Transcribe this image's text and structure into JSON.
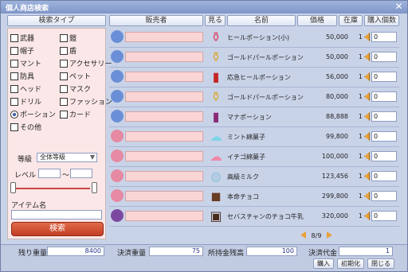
{
  "window": {
    "title": "個人商店検索",
    "close_glyph": "✕"
  },
  "left": {
    "header": "検索タイプ",
    "checkboxes": [
      {
        "label": "武器",
        "checked": false
      },
      {
        "label": "鎧",
        "checked": false
      },
      {
        "label": "帽子",
        "checked": false
      },
      {
        "label": "盾",
        "checked": false
      },
      {
        "label": "マント",
        "checked": false
      },
      {
        "label": "アクセサリー",
        "checked": false
      },
      {
        "label": "防具",
        "checked": false
      },
      {
        "label": "ペット",
        "checked": false
      },
      {
        "label": "ヘッド",
        "checked": false
      },
      {
        "label": "マスク",
        "checked": false
      },
      {
        "label": "ドリル",
        "checked": false
      },
      {
        "label": "ファッション",
        "checked": false
      },
      {
        "label": "ポーション",
        "checked": true
      },
      {
        "label": "カード",
        "checked": false
      },
      {
        "label": "その他",
        "checked": false
      }
    ],
    "grade_label": "等級",
    "grade_value": "全体等級",
    "level_label": "レベル",
    "level_sep": "～",
    "item_name_label": "アイテム名",
    "item_name_value": "",
    "search_button": "検索"
  },
  "table": {
    "headers": {
      "seller": "販売者",
      "view": "見る",
      "name": "名前",
      "price": "価格",
      "stock": "在庫",
      "qty": "購入個数"
    },
    "rows": [
      {
        "name": "ヒールポーション(小)",
        "price": "50,000",
        "stock": "1",
        "qty": "0",
        "seller_icon": "blue-spiky-avatar",
        "item_icon": "small-heal-potion-icon"
      },
      {
        "name": "ゴールドパールポーション",
        "price": "50,000",
        "stock": "1",
        "qty": "0",
        "seller_icon": "blue-spiky-avatar",
        "item_icon": "gold-pearl-potion-icon"
      },
      {
        "name": "応急ヒールポーション",
        "price": "56,000",
        "stock": "1",
        "qty": "0",
        "seller_icon": "blue-spiky-avatar",
        "item_icon": "red-potion-bottle-icon"
      },
      {
        "name": "ゴールドパールポーション",
        "price": "80,000",
        "stock": "1",
        "qty": "0",
        "seller_icon": "blue-spiky-avatar",
        "item_icon": "gold-pearl-potion-icon"
      },
      {
        "name": "マナポーション",
        "price": "88,888",
        "stock": "1",
        "qty": "0",
        "seller_icon": "blue-spiky-avatar",
        "item_icon": "mana-potion-icon"
      },
      {
        "name": "ミント綿菓子",
        "price": "99,800",
        "stock": "1",
        "qty": "0",
        "seller_icon": "pink-avatar",
        "item_icon": "mint-cotton-candy-icon"
      },
      {
        "name": "イチゴ綿菓子",
        "price": "100,000",
        "stock": "1",
        "qty": "0",
        "seller_icon": "pink-avatar",
        "item_icon": "strawberry-cotton-candy-icon"
      },
      {
        "name": "高級ミルク",
        "price": "123,456",
        "stock": "1",
        "qty": "0",
        "seller_icon": "pink-avatar",
        "item_icon": "milk-bottle-icon"
      },
      {
        "name": "本命チョコ",
        "price": "299,800",
        "stock": "1",
        "qty": "0",
        "seller_icon": "pink-avatar",
        "item_icon": "chocolate-icon"
      },
      {
        "name": "セバスチャンのチョコ牛乳",
        "price": "320,000",
        "stock": "1",
        "qty": "0",
        "seller_icon": "purple-avatar",
        "item_icon": "choco-milk-icon"
      }
    ],
    "page": "8/9"
  },
  "bottom": {
    "remaining_weight_label": "残り重量",
    "remaining_weight": "8400",
    "settle_weight_label": "決済重量",
    "settle_weight": "75",
    "money_label": "所持金残高",
    "money": "100",
    "settle_cost_label": "決済代金",
    "settle_cost": "1",
    "buy_button": "購入",
    "reset_button": "初期化",
    "close_button": "閉じる"
  },
  "colors": {
    "seller_blue": "#6b8fd6",
    "seller_pink": "#e58aa2",
    "seller_purple": "#7b4aa0",
    "accent_orange": "#e8a23a",
    "search_red": "#c13e24"
  }
}
